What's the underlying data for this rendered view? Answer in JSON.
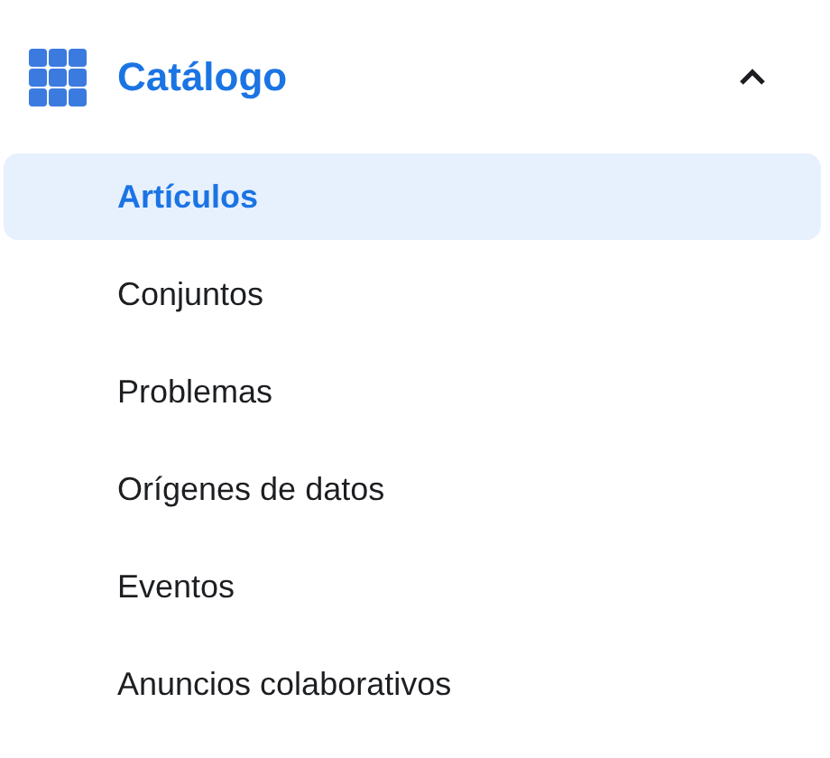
{
  "section": {
    "title": "Catálogo",
    "expanded": true
  },
  "items": [
    {
      "label": "Artículos",
      "selected": true
    },
    {
      "label": "Conjuntos",
      "selected": false
    },
    {
      "label": "Problemas",
      "selected": false
    },
    {
      "label": "Orígenes de datos",
      "selected": false
    },
    {
      "label": "Eventos",
      "selected": false
    },
    {
      "label": "Anuncios colaborativos",
      "selected": false
    }
  ]
}
